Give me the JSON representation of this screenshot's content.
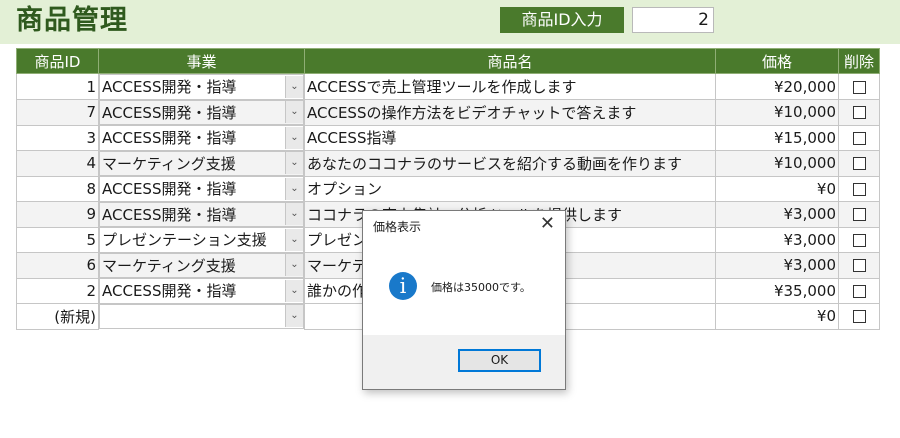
{
  "header": {
    "title": "商品管理",
    "id_label": "商品ID入力",
    "id_value": "2"
  },
  "table": {
    "columns": [
      "商品ID",
      "事業",
      "商品名",
      "価格",
      "削除"
    ],
    "rows": [
      {
        "id": "1",
        "business": "ACCESS開発・指導",
        "name": "ACCESSで売上管理ツールを作成します",
        "price": "¥20,000"
      },
      {
        "id": "7",
        "business": "ACCESS開発・指導",
        "name": "ACCESSの操作方法をビデオチャットで答えます",
        "price": "¥10,000"
      },
      {
        "id": "3",
        "business": "ACCESS開発・指導",
        "name": "ACCESS指導",
        "price": "¥15,000"
      },
      {
        "id": "4",
        "business": "マーケティング支援",
        "name": "あなたのココナラのサービスを紹介する動画を作ります",
        "price": "¥10,000"
      },
      {
        "id": "8",
        "business": "ACCESS開発・指導",
        "name": "オプション",
        "price": "¥0"
      },
      {
        "id": "9",
        "business": "ACCESS開発・指導",
        "name": "ココナラの売上集計・分析ツールを提供します",
        "price": "¥3,000"
      },
      {
        "id": "5",
        "business": "プレゼンテーション支援",
        "name": "プレゼンテ",
        "price": "¥3,000"
      },
      {
        "id": "6",
        "business": "マーケティング支援",
        "name": "マーケティ",
        "price": "¥3,000"
      },
      {
        "id": "2",
        "business": "ACCESS開発・指導",
        "name": "誰かの作",
        "price": "¥35,000"
      }
    ],
    "new_row": {
      "id": "(新規)",
      "business": "",
      "name": "",
      "price": "¥0"
    }
  },
  "dialog": {
    "title": "価格表示",
    "close": "✕",
    "icon": "info-icon",
    "message": "価格は35000です。",
    "ok": "OK"
  },
  "colors": {
    "header_bg": "#e3f0d6",
    "accent": "#4a7a2c",
    "title": "#2f5a1e",
    "info": "#1979ca",
    "ok_border": "#0078d7"
  }
}
